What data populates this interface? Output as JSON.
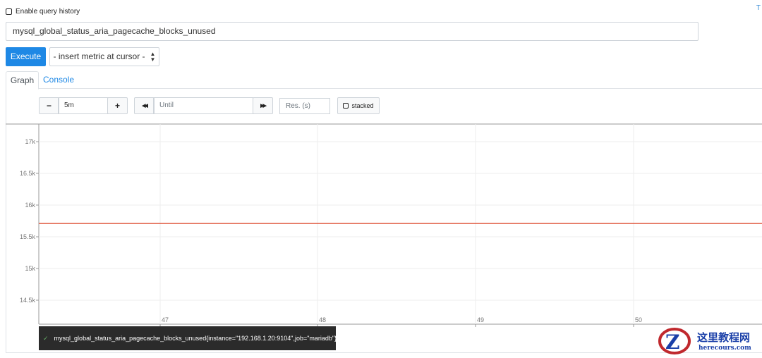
{
  "query_history": {
    "label": "Enable query history",
    "checked": false
  },
  "top_right_link": "T",
  "expression": {
    "value": "mysql_global_status_aria_pagecache_blocks_unused"
  },
  "execute_label": "Execute",
  "metric_select": {
    "label": "- insert metric at cursor -"
  },
  "tabs": [
    {
      "label": "Graph",
      "active": true
    },
    {
      "label": "Console",
      "active": false
    }
  ],
  "controls": {
    "minus": "−",
    "range": "5m",
    "plus": "+",
    "back": "◀◀",
    "until_placeholder": "Until",
    "forward": "▶▶",
    "res_placeholder": "Res. (s)",
    "stacked_label": "stacked"
  },
  "chart_data": {
    "type": "line",
    "y_ticks": [
      "17k",
      "16.5k",
      "16k",
      "15.5k",
      "15k",
      "14.5k"
    ],
    "y_tick_values": [
      17000,
      16500,
      16000,
      15500,
      15000,
      14500
    ],
    "x_ticks": [
      "47",
      "48",
      "49",
      "50"
    ],
    "series": [
      {
        "name": "mysql_global_status_aria_pagecache_blocks_unused{instance=\"192.168.1.20:9104\",job=\"mariadb\"}",
        "color": "#e05d44",
        "values": [
          15710,
          15710,
          15710,
          15710,
          15710
        ]
      }
    ],
    "grid": true
  },
  "legend": {
    "check": "✓",
    "label": "mysql_global_status_aria_pagecache_blocks_unused{instance=\"192.168.1.20:9104\",job=\"mariadb\"}"
  },
  "watermark": {
    "title": "这里教程网",
    "url": "herecours.com"
  }
}
